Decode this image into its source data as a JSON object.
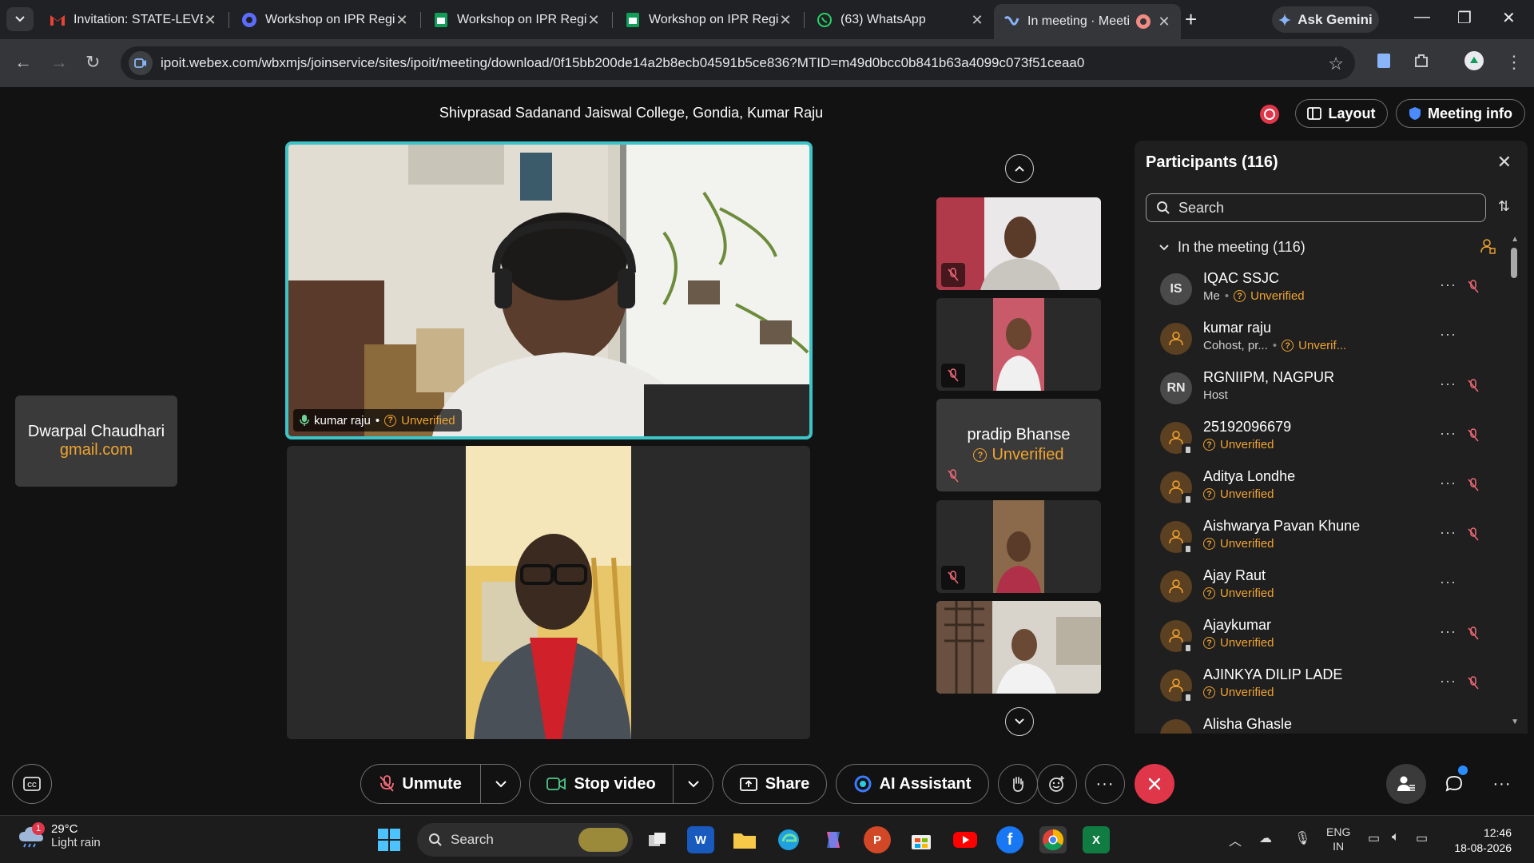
{
  "browser": {
    "tabs": [
      {
        "title": "Invitation: STATE-LEVEL",
        "icon": "gmail-icon"
      },
      {
        "title": "Workshop on IPR Regi",
        "icon": "webex-icon"
      },
      {
        "title": "Workshop on IPR Regi",
        "icon": "sheets-icon"
      },
      {
        "title": "Workshop on IPR Regi",
        "icon": "sheets-icon"
      },
      {
        "title": "(63) WhatsApp",
        "icon": "whatsapp-icon"
      },
      {
        "title": "In meeting · Meeti",
        "icon": "webex-icon",
        "active": true
      }
    ],
    "gemini_label": "Ask Gemini",
    "url": "ipoit.webex.com/wbxmjs/joinservice/sites/ipoit/meeting/download/0f15bb200de14a2b8ecb04591b5ce836?MTID=m49d0bcc0b841b63a4099c073f51ceaa0"
  },
  "meeting": {
    "title": "Shivprasad Sadanand Jaiswal College, Gondia, Kumar Raju",
    "layout_label": "Layout",
    "info_label": "Meeting info",
    "active_speaker": {
      "name": "kumar raju",
      "status": "Unverified"
    },
    "side_card": {
      "name": "Dwarpal Chaudhari",
      "email": "gmail.com"
    },
    "thumb_card": {
      "name": "pradip Bhanse",
      "status": "Unverified"
    }
  },
  "participants": {
    "title": "Participants (116)",
    "search_placeholder": "Search",
    "section_label": "In the meeting (116)",
    "items": [
      {
        "name": "IQAC SSJC",
        "initials": "IS",
        "role": "Me",
        "status": "Unverified",
        "muted": true
      },
      {
        "name": "kumar raju",
        "initials": "",
        "role": "Cohost, pr...",
        "status": "Unverif...",
        "muted": false
      },
      {
        "name": "RGNIIPM, NAGPUR",
        "initials": "RN",
        "role": "Host",
        "status": "",
        "muted": true
      },
      {
        "name": "25192096679",
        "initials": "",
        "role": "",
        "status": "Unverified",
        "muted": true
      },
      {
        "name": "Aditya Londhe",
        "initials": "",
        "role": "",
        "status": "Unverified",
        "muted": true
      },
      {
        "name": "Aishwarya Pavan Khune",
        "initials": "",
        "role": "",
        "status": "Unverified",
        "muted": true
      },
      {
        "name": "Ajay Raut",
        "initials": "",
        "role": "",
        "status": "Unverified",
        "muted": false
      },
      {
        "name": "Ajaykumar",
        "initials": "",
        "role": "",
        "status": "Unverified",
        "muted": true
      },
      {
        "name": "AJINKYA DILIP LADE",
        "initials": "",
        "role": "",
        "status": "Unverified",
        "muted": true
      },
      {
        "name": "Alisha Ghasle",
        "initials": "",
        "role": "",
        "status": "",
        "muted": false
      }
    ]
  },
  "controls": {
    "unmute": "Unmute",
    "stop_video": "Stop video",
    "share": "Share",
    "ai_assistant": "AI Assistant"
  },
  "taskbar": {
    "temp": "29°C",
    "weather": "Light rain",
    "weather_badge": "1",
    "search": "Search",
    "lang1": "ENG",
    "lang2": "IN",
    "time": "12:46",
    "date": "18-08-2026"
  },
  "colors": {
    "accent": "#3cc4c8",
    "warning": "#f0a330",
    "end_call": "#e0364a"
  }
}
